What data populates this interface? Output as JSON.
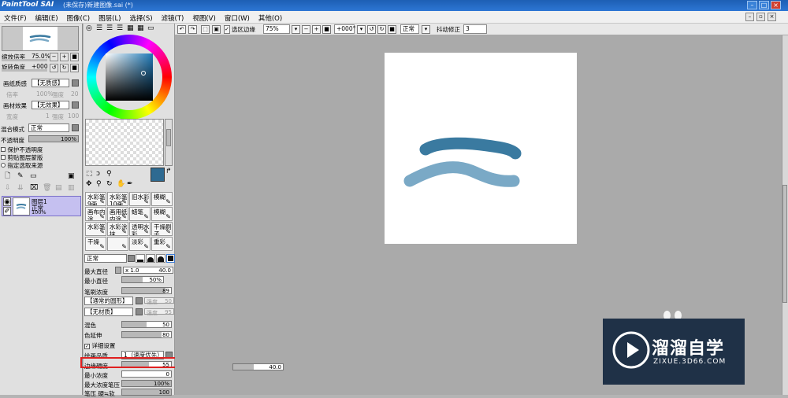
{
  "app": {
    "logo": "PaintTool SAI",
    "title": "(未保存)新建图像.sai (*)"
  },
  "menu": [
    "文件(F)",
    "编辑(E)",
    "图像(C)",
    "图层(L)",
    "选择(S)",
    "滤镜(T)",
    "视图(V)",
    "窗口(W)",
    "其他(O)"
  ],
  "toolbar": {
    "selection_edge": "选区边缘",
    "zoom": "75%",
    "rotation": "+000°",
    "blend": "正常",
    "stabilizer_label": "抖动修正",
    "stabilizer_value": "3"
  },
  "navigator": {
    "zoom_label": "缩放倍率",
    "zoom_value": "75.0%",
    "rotate_label": "旋转角度",
    "rotate_value": "+000"
  },
  "layer_props": {
    "paper_texture_label": "画纸质感",
    "paper_texture_value": "【无质感】",
    "scale_label": "倍率",
    "scale_value": "100%",
    "strength_label": "强度",
    "strength_value": "20",
    "paper_effect_label": "画材效果",
    "paper_effect_value": "【无效果】",
    "width_label": "宽度",
    "width_value": "1",
    "strength2_label": "强度",
    "strength2_value": "100",
    "blend_label": "混合模式",
    "blend_value": "正常",
    "opacity_label": "不透明度",
    "opacity_value": "100%",
    "opacity_level": 1.0,
    "protect_alpha": "保护不透明度",
    "clipping": "剪贴图层蒙版",
    "selection_source": "指定选取来源"
  },
  "layer": {
    "name": "图层1",
    "mode": "正常",
    "opacity": "100%"
  },
  "colors": {
    "primary": "#2e6a91",
    "secondary": "#ffffff",
    "stroke_dark": "#3a7aa0",
    "stroke_light": "#7aa9c6",
    "accent": "#3b7bd6"
  },
  "tools": [
    [
      "水彩笔9画",
      "水彩笔10画",
      "旧水彩",
      "模糊"
    ],
    [
      "画布内涂",
      "画用纸内涂",
      "蜡笔",
      "模糊"
    ],
    [
      "水彩笔",
      "水彩涂抹",
      "透明水彩",
      "干燥刷子"
    ],
    [
      "干燥",
      "",
      "淡彩",
      "重彩"
    ]
  ],
  "brush": {
    "mode": "正常",
    "max_size_label": "最大直径",
    "max_size_mult": "x 1.0",
    "max_size_value": "40.0",
    "min_size_label": "最小直径",
    "min_size_value": "50%",
    "min_size_level": 0.5,
    "density_label": "笔刷浓度",
    "density_value": "89",
    "density_level": 0.89,
    "shape": "【通常的圆形】",
    "shape_strength_label": "强度",
    "shape_strength_value": "50",
    "texture": "【无材质】",
    "texture_strength_label": "强度",
    "texture_strength_value": "95",
    "blending_label": "混色",
    "blending_value": "50",
    "blending_level": 0.5,
    "dilution_label": "色延伸",
    "dilution_value": "80",
    "dilution_level": 0.8,
    "detail_label": "详细设置",
    "quality_label": "绘画品质",
    "quality_value": "1（速度优先）",
    "edge_label": "边缘硬度",
    "edge_value": "55",
    "edge_level": 0.55,
    "min_density_label": "最小浓度",
    "min_density_value": "0",
    "min_density_level": 0,
    "max_pressure_label": "最大浓度笔压",
    "max_pressure_value": "100%",
    "max_pressure_level": 1.0,
    "pressure_label": "笔压 硬≒软",
    "pressure_value": "100",
    "pressure_level": 1.0
  },
  "floating": {
    "size_value": "40.0"
  },
  "watermark": {
    "title": "溜溜自学",
    "url": "ZIXUE.3D66.COM"
  }
}
